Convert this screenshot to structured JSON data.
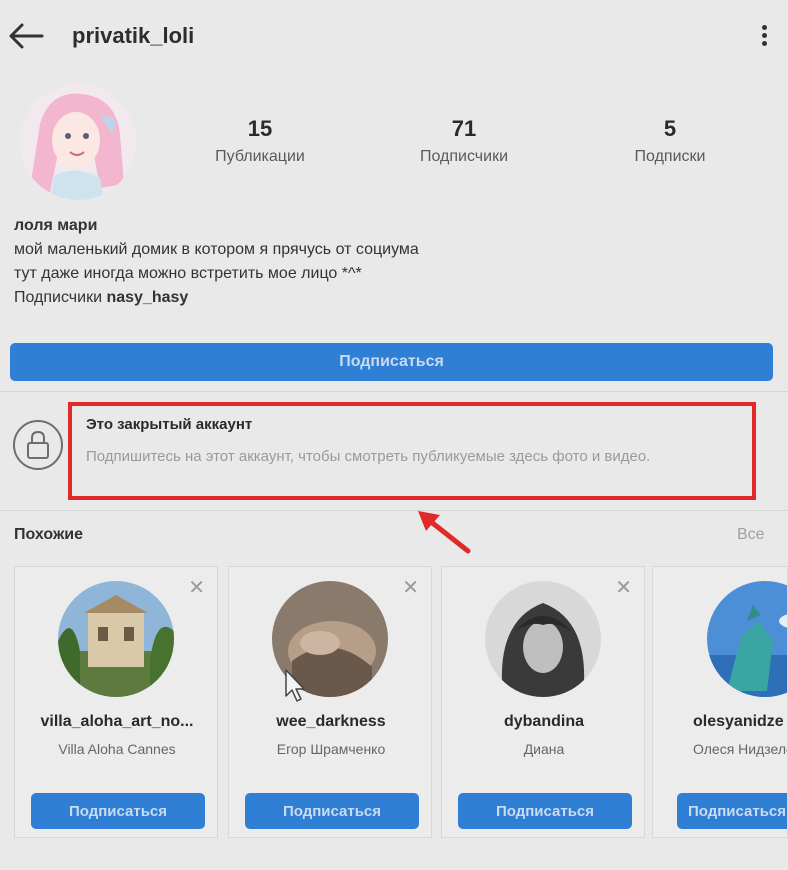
{
  "header": {
    "username": "privatik_loli"
  },
  "profile": {
    "stats": [
      {
        "value": "15",
        "label": "Публикации"
      },
      {
        "value": "71",
        "label": "Подписчики"
      },
      {
        "value": "5",
        "label": "Подписки"
      }
    ],
    "display_name": "лоля мари",
    "bio_line1": "мой маленький домик в котором я прячусь от социума",
    "bio_line2": "тут даже иногда можно встретить мое лицо *^*",
    "followed_by_prefix": "Подписчики",
    "followed_by_user": "nasy_hasy",
    "follow_button": "Подписаться"
  },
  "private_notice": {
    "title": "Это закрытый аккаунт",
    "description": "Подпишитесь на этот аккаунт, чтобы смотреть публикуемые здесь фото и видео."
  },
  "similar": {
    "header": "Похожие",
    "see_all": "Все",
    "close_glyph": "✕",
    "cards": [
      {
        "username": "villa_aloha_art_no...",
        "name": "Villa Aloha Cannes",
        "button": "Подписаться"
      },
      {
        "username": "wee_darkness",
        "name": "Егор Шрамченко",
        "button": "Подписаться"
      },
      {
        "username": "dybandina",
        "name": "Диана",
        "button": "Подписаться"
      },
      {
        "username": "olesyanidze",
        "name": "Олеся Нидзеле",
        "button": "Подписаться"
      }
    ]
  },
  "colors": {
    "accent": "#2f7fd5",
    "highlight": "#e02a2a",
    "background": "#e9e9e9"
  }
}
